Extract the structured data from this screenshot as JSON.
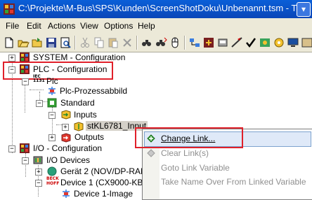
{
  "window": {
    "title": "C:\\Projekte\\M-Bus\\SPS\\Kunden\\ScreenShotDoku\\Unbenannt.tsm - T",
    "control_glyph": "▾"
  },
  "menu": [
    "File",
    "Edit",
    "Actions",
    "View",
    "Options",
    "Help"
  ],
  "toolbar": {
    "buttons": [
      "new-icon",
      "open-icon",
      "open-folder-icon",
      "save-icon",
      "preview-icon",
      "cut-icon",
      "copy-icon",
      "paste-icon",
      "delete-icon",
      "find-icon",
      "find-next-icon",
      "mouse-icon",
      "network-icon",
      "check-icon",
      "activate-icon",
      "config-icon",
      "more-icon"
    ]
  },
  "tree": {
    "system": "SYSTEM - Configuration",
    "plc": "PLC - Configuration",
    "plc_badge": "IEC\n1131",
    "plc_project": "Plc",
    "plc_process_image": "Plc-Prozessabbild",
    "standard": "Standard",
    "inputs": "Inputs",
    "input_var": "stKL6781_Input",
    "outputs": "Outputs",
    "io": "I/O - Configuration",
    "io_devices": "I/O Devices",
    "device2": "Gerät 2 (NOV/DP-RAM)",
    "device1": "Device 1 (CX9000-KBus)",
    "device1_image": "Device 1-Image",
    "beckhoff_badge": "BECK\nHOFF"
  },
  "context_menu": {
    "items": [
      {
        "label": "Change Link...",
        "enabled": true
      },
      {
        "label": "Clear Link(s)",
        "enabled": false
      },
      {
        "label": "Goto Link Variable",
        "enabled": false
      },
      {
        "label": "Take Name Over From Linked Variable",
        "enabled": false
      }
    ]
  },
  "colors": {
    "titlebar": "#0a46b8",
    "highlight_box": "#e0202a",
    "menu_hover": "#dfe9f8"
  }
}
